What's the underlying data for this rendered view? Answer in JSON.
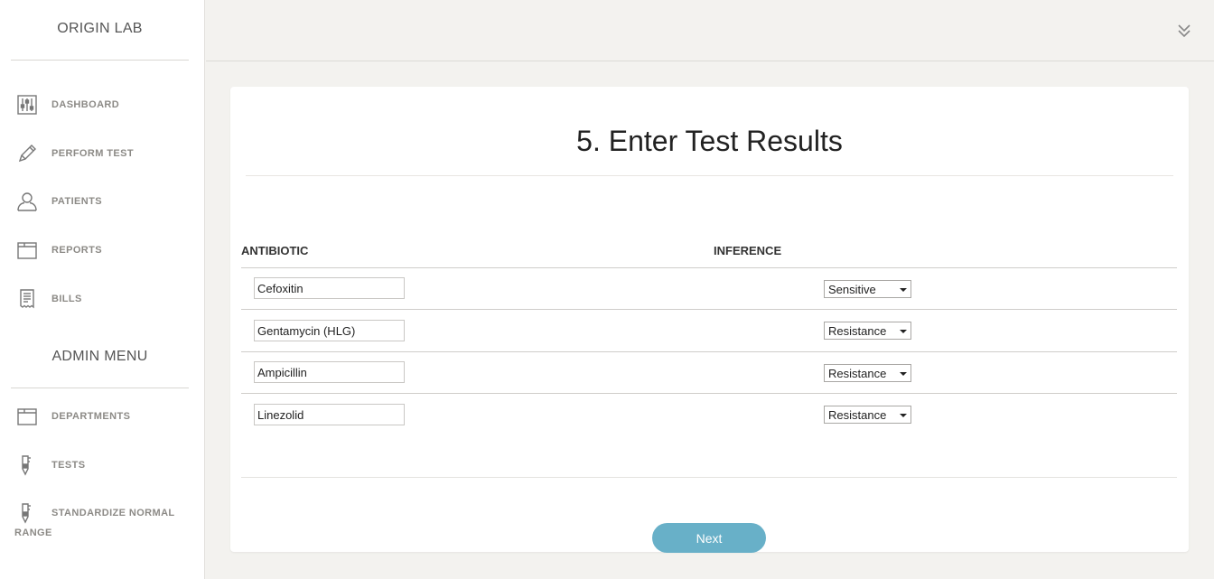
{
  "sidebar": {
    "brand": "ORIGIN LAB",
    "items": [
      {
        "label": "DASHBOARD",
        "icon": "sliders-icon"
      },
      {
        "label": "PERFORM TEST",
        "icon": "pencil-icon"
      },
      {
        "label": "PATIENTS",
        "icon": "user-icon"
      },
      {
        "label": "REPORTS",
        "icon": "folder-icon"
      },
      {
        "label": "BILLS",
        "icon": "receipt-icon"
      }
    ],
    "admin_title": "ADMIN MENU",
    "admin_items": [
      {
        "label": "DEPARTMENTS",
        "icon": "folder-icon"
      },
      {
        "label": "TESTS",
        "icon": "test-tube-icon"
      },
      {
        "label_line1": "STANDARDIZE NORMAL",
        "label_line2": "RANGE",
        "icon": "test-tube-icon"
      }
    ]
  },
  "topbar": {
    "toggle_icon": "double-chevron-down-icon"
  },
  "main": {
    "title": "5. Enter Test Results",
    "columns": {
      "antibiotic": "ANTIBIOTIC",
      "inference": "INFERENCE"
    },
    "rows": [
      {
        "antibiotic": "Cefoxitin",
        "inference": "Sensitive"
      },
      {
        "antibiotic": "Gentamycin (HLG)",
        "inference": "Resistance"
      },
      {
        "antibiotic": "Ampicillin",
        "inference": "Resistance"
      },
      {
        "antibiotic": "Linezolid",
        "inference": "Resistance"
      }
    ],
    "next_label": "Next"
  },
  "colors": {
    "accent": "#68b0c8",
    "background": "#f3f2ef"
  }
}
